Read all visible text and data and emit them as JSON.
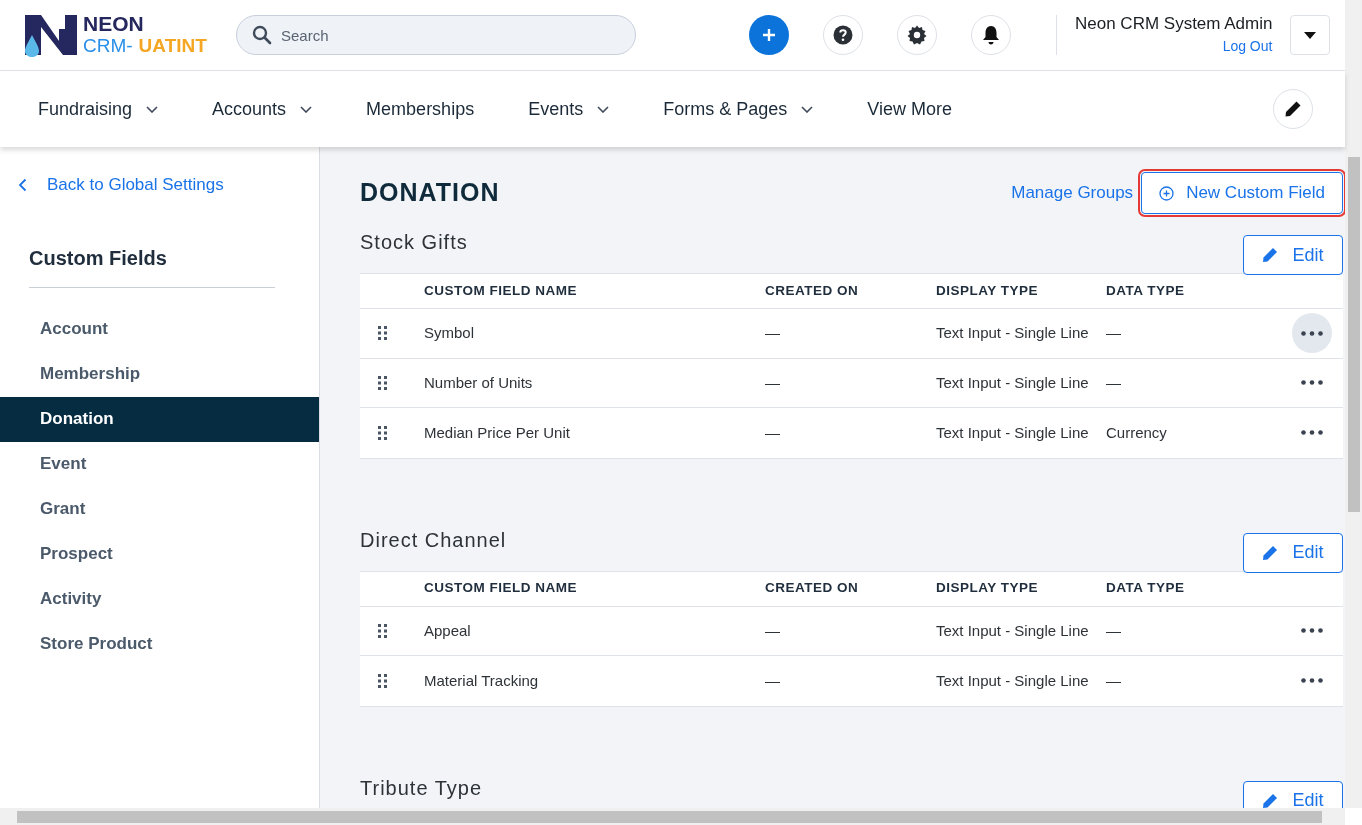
{
  "logo": {
    "name": "NEON",
    "product": "CRM-",
    "env": "UATINT"
  },
  "search": {
    "placeholder": "Search"
  },
  "user": {
    "name": "Neon CRM System Admin",
    "logout": "Log Out"
  },
  "nav": [
    {
      "label": "Fundraising",
      "has_menu": true
    },
    {
      "label": "Accounts",
      "has_menu": true
    },
    {
      "label": "Memberships",
      "has_menu": false
    },
    {
      "label": "Events",
      "has_menu": true
    },
    {
      "label": "Forms & Pages",
      "has_menu": true
    },
    {
      "label": "View More",
      "has_menu": false
    }
  ],
  "sidebar": {
    "back": "Back to Global Settings",
    "title": "Custom Fields",
    "items": [
      {
        "label": "Account",
        "selected": false
      },
      {
        "label": "Membership",
        "selected": false
      },
      {
        "label": "Donation",
        "selected": true
      },
      {
        "label": "Event",
        "selected": false
      },
      {
        "label": "Grant",
        "selected": false
      },
      {
        "label": "Prospect",
        "selected": false
      },
      {
        "label": "Activity",
        "selected": false
      },
      {
        "label": "Store Product",
        "selected": false
      }
    ]
  },
  "page": {
    "title": "DONATION",
    "manage_groups": "Manage Groups",
    "new_field": {
      "label": "New Custom Field",
      "highlighted": true
    }
  },
  "groups": [
    {
      "title": "Stock Gifts",
      "edit": "Edit",
      "columns": [
        "CUSTOM FIELD NAME",
        "CREATED ON",
        "DISPLAY TYPE",
        "DATA TYPE"
      ],
      "rows": [
        {
          "cells": [
            "Symbol",
            "—",
            "Text Input - Single Line",
            "—"
          ],
          "hovered": true
        },
        {
          "cells": [
            "Number of Units",
            "—",
            "Text Input - Single Line",
            "—"
          ],
          "hovered": false
        },
        {
          "cells": [
            "Median Price Per Unit",
            "—",
            "Text Input - Single Line",
            "Currency"
          ],
          "hovered": false
        }
      ]
    },
    {
      "title": "Direct Channel",
      "edit": "Edit",
      "columns": [
        "CUSTOM FIELD NAME",
        "CREATED ON",
        "DISPLAY TYPE",
        "DATA TYPE"
      ],
      "rows": [
        {
          "cells": [
            "Appeal",
            "—",
            "Text Input - Single Line",
            "—"
          ],
          "hovered": false
        },
        {
          "cells": [
            "Material Tracking",
            "—",
            "Text Input - Single Line",
            "—"
          ],
          "hovered": false
        }
      ]
    },
    {
      "title": "Tribute Type",
      "edit": "Edit"
    }
  ]
}
